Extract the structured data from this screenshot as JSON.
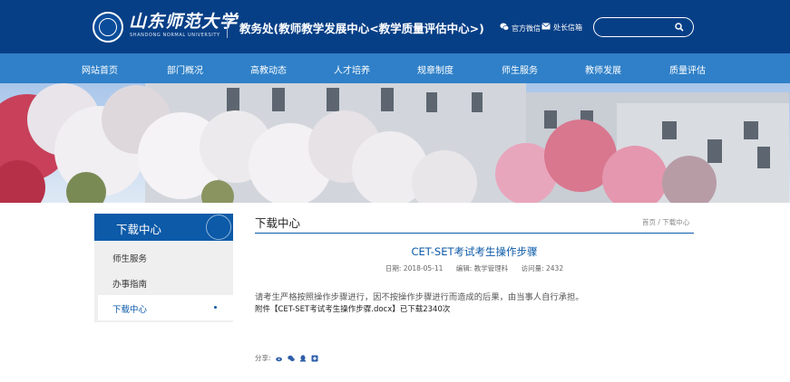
{
  "header": {
    "logo_name": "山东师范大学",
    "logo_sub": "SHANDONG NORMAL UNIVERSITY",
    "dept_title": "教务处(教师教学发展中心<教学质量评估中心>)",
    "wechat_label": "官方微信",
    "mail_label": "处长信箱",
    "search_placeholder": ""
  },
  "nav": [
    "网站首页",
    "部门概况",
    "高教动态",
    "人才培养",
    "规章制度",
    "师生服务",
    "教师发展",
    "质量评估"
  ],
  "sidebar": {
    "title": "下载中心",
    "items": [
      {
        "label": "师生服务",
        "active": false
      },
      {
        "label": "办事指南",
        "active": false
      },
      {
        "label": "下载中心",
        "active": true
      }
    ]
  },
  "content": {
    "section_title": "下载中心",
    "breadcrumb": "首页 / 下载中心",
    "article_title": "CET-SET考试考生操作步骤",
    "meta": {
      "date": "日期:   2018-05-11",
      "editor": "编辑:   教学管理科",
      "views": "访问量:   2432"
    },
    "body": "请考生严格按照操作步骤进行，因不按操作步骤进行而造成的后果，由当事人自行承担。",
    "attachment": "附件【CET-SET考试考生操作步骤.docx】已下载2340次",
    "share_label": "分享:"
  },
  "colors": {
    "header_bg": "#073f86",
    "nav_bg": "#2f80c8",
    "accent": "#0c5aa8",
    "sidebar_bg": "#efefef"
  }
}
